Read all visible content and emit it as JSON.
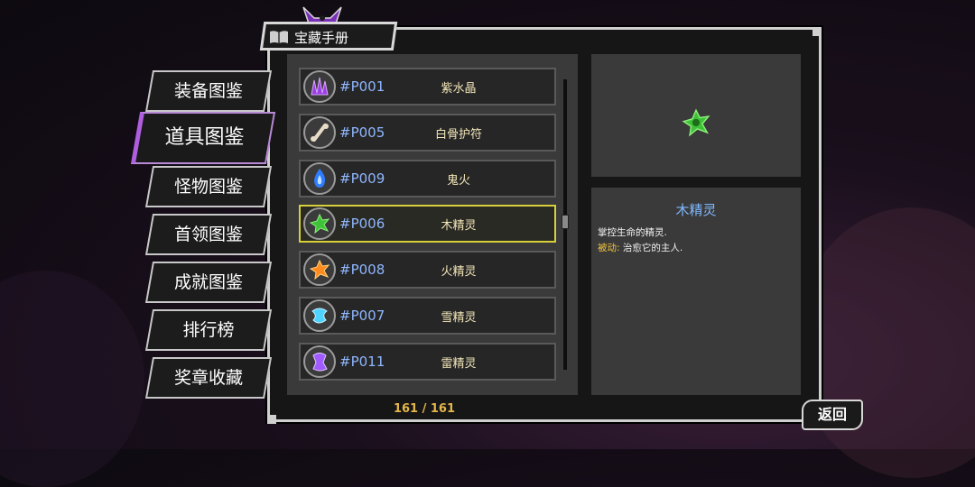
{
  "header": {
    "title": "宝藏手册"
  },
  "tabs": [
    {
      "label": "装备图鉴",
      "active": false
    },
    {
      "label": "道具图鉴",
      "active": true
    },
    {
      "label": "怪物图鉴",
      "active": false
    },
    {
      "label": "首领图鉴",
      "active": false
    },
    {
      "label": "成就图鉴",
      "active": false
    },
    {
      "label": "排行榜",
      "active": false
    },
    {
      "label": "奖章收藏",
      "active": false
    }
  ],
  "items": [
    {
      "code": "#P001",
      "name": "紫水晶",
      "icon": "amethyst-icon",
      "color": "#9b3fe0"
    },
    {
      "code": "#P005",
      "name": "白骨护符",
      "icon": "bone-icon",
      "color": "#e8dcc8"
    },
    {
      "code": "#P009",
      "name": "鬼火",
      "icon": "ghost-fire-icon",
      "color": "#3a8cff"
    },
    {
      "code": "#P006",
      "name": "木精灵",
      "icon": "wood-spirit-icon",
      "color": "#3fc23a",
      "selected": true
    },
    {
      "code": "#P008",
      "name": "火精灵",
      "icon": "fire-spirit-icon",
      "color": "#ff8a1f"
    },
    {
      "code": "#P007",
      "name": "雪精灵",
      "icon": "snow-spirit-icon",
      "color": "#4fd2ff"
    },
    {
      "code": "#P011",
      "name": "雷精灵",
      "icon": "thunder-spirit-icon",
      "color": "#a05cff"
    }
  ],
  "counter": "161 / 161",
  "detail": {
    "name": "木精灵",
    "line1": "掌控生命的精灵.",
    "passive_label": "被动:",
    "passive_text": "治愈它的主人."
  },
  "back_label": "返回"
}
